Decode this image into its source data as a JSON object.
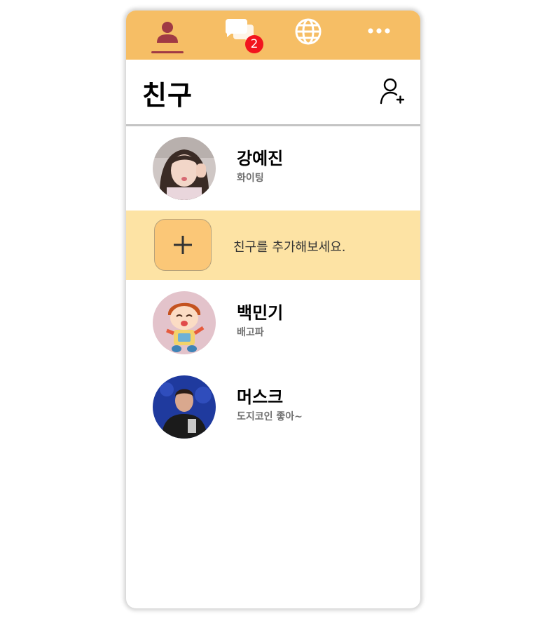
{
  "nav": {
    "tabs": [
      {
        "icon": "person-icon",
        "active": true
      },
      {
        "icon": "chat-bubbles-icon",
        "badge": "2"
      },
      {
        "icon": "globe-icon"
      },
      {
        "icon": "more-icon"
      }
    ]
  },
  "header": {
    "title": "친구",
    "add_friend_icon": "add-person-icon"
  },
  "friends": [
    {
      "name": "강예진",
      "status": "화이팅",
      "avatar": "photo-avatar"
    },
    {
      "name": "백민기",
      "status": "배고파",
      "avatar": "cartoon-avatar"
    },
    {
      "name": "머스크",
      "status": "도지코인 좋아~",
      "avatar": "photo-avatar"
    }
  ],
  "add_friend_row": {
    "text": "친구를 추가해보세요.",
    "icon": "plus-icon"
  },
  "colors": {
    "topbar": "#f6be65",
    "active_tab": "#a03a44",
    "badge": "#f2141e",
    "add_row_bg": "#fde3a4",
    "add_button_bg": "#fbc777"
  }
}
